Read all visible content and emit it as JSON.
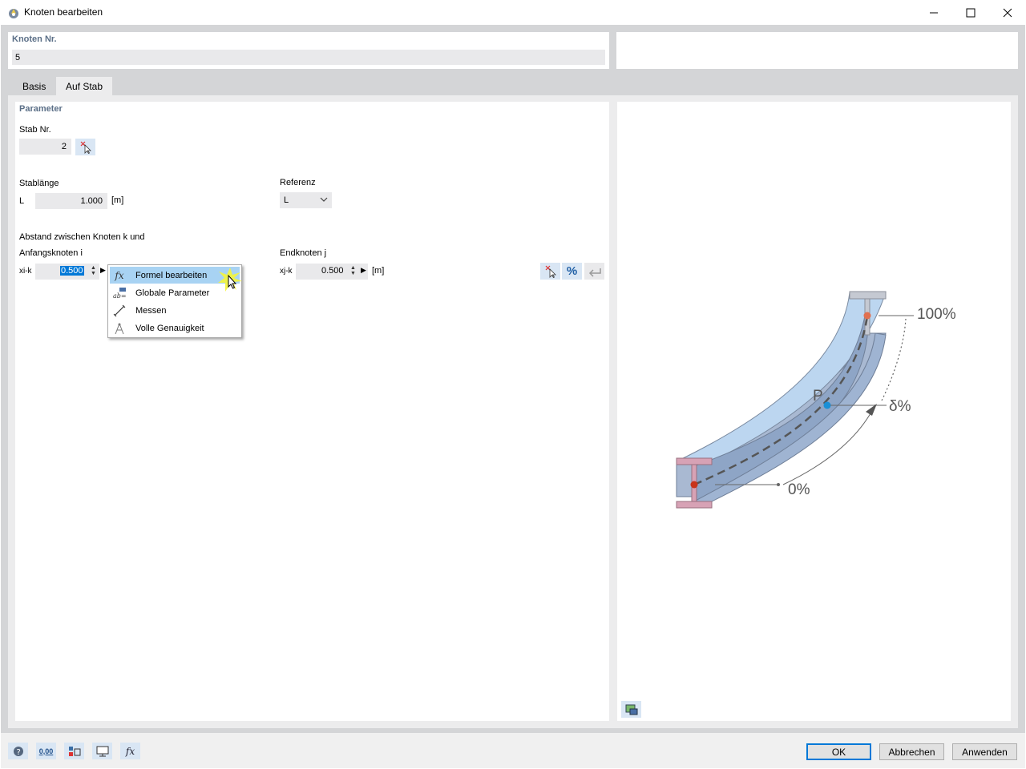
{
  "window": {
    "title": "Knoten bearbeiten",
    "minimize_icon": "minimize-icon",
    "maximize_icon": "maximize-icon",
    "close_icon": "close-icon"
  },
  "header": {
    "node_label": "Knoten Nr.",
    "node_value": "5"
  },
  "tabs": [
    {
      "label": "Basis",
      "active": false
    },
    {
      "label": "Auf Stab",
      "active": true
    }
  ],
  "parameters": {
    "section_title": "Parameter",
    "stab_label": "Stab Nr.",
    "stab_value": "2",
    "length_label": "Stablänge",
    "length_symbol": "L",
    "length_value": "1.000",
    "length_unit": "[m]",
    "reference_label": "Referenz",
    "reference_value": "L",
    "distance_label": "Abstand zwischen Knoten k und",
    "start_label": "Anfangsknoten i",
    "xi_symbol": "xi-k",
    "xi_value": "0.500",
    "end_label": "Endknoten j",
    "xj_symbol": "xj-k",
    "xj_value": "0.500",
    "xj_unit": "[m]",
    "percent_label": "%"
  },
  "context_menu": {
    "items": [
      {
        "label": "Formel bearbeiten",
        "icon": "formula-icon",
        "highlighted": true
      },
      {
        "label": "Globale Parameter",
        "icon": "global-parameters-icon",
        "highlighted": false
      },
      {
        "label": "Messen",
        "icon": "measure-icon",
        "highlighted": false
      },
      {
        "label": "Volle Genauigkeit",
        "icon": "precision-icon",
        "highlighted": false
      }
    ]
  },
  "diagram": {
    "label_100": "100%",
    "label_p": "P",
    "label_delta": "δ%",
    "label_0": "0%",
    "colors": {
      "start_point": "#c8341a",
      "mid_point": "#1a8fd6",
      "end_point": "#e07050",
      "flange": "#c9a0b0",
      "beam_top": "#b8d4ee"
    }
  },
  "bottom": {
    "ok": "OK",
    "cancel": "Abbrechen",
    "apply": "Anwenden",
    "units_icon_text": "0,00"
  }
}
